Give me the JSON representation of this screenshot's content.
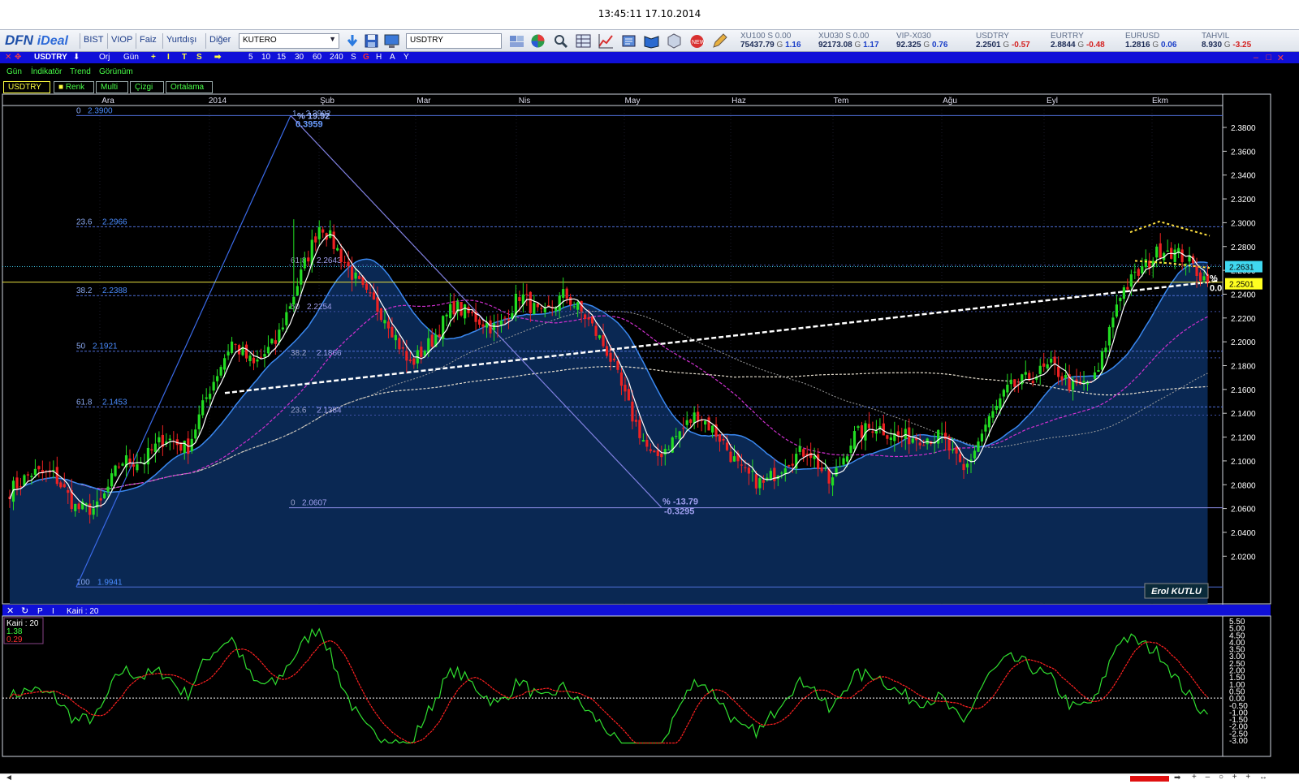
{
  "window": {
    "timestamp": "13:45:11 17.10.2014"
  },
  "toolbar": {
    "logo_dfn": "DFN",
    "logo_ideal": "iDeal",
    "menu": [
      "BIST",
      "VIOP",
      "Faiz",
      "Yurtdışı",
      "Diğer"
    ],
    "broker_value": "KUTERO",
    "symbol_value": "USDTRY",
    "icons": [
      "download-icon",
      "save-icon",
      "monitor-icon",
      "layout-icon",
      "globe-icon",
      "search-icon",
      "table-icon",
      "chart-icon",
      "news-icon",
      "book-icon",
      "cube-icon",
      "alert-icon",
      "pen-icon"
    ]
  },
  "quotes": [
    {
      "name": "XU100",
      "s": "S 0.00",
      "value": "75437.79",
      "g_label": "G",
      "change": "1.16",
      "dir": "pos"
    },
    {
      "name": "XU030",
      "s": "S 0.00",
      "value": "92173.08",
      "g_label": "G",
      "change": "1.17",
      "dir": "pos"
    },
    {
      "name": "VIP-X030",
      "s": "",
      "value": "92.325",
      "g_label": "G",
      "change": "0.76",
      "dir": "pos"
    },
    {
      "name": "USDTRY",
      "s": "",
      "value": "2.2501",
      "g_label": "G",
      "change": "-0.57",
      "dir": "neg"
    },
    {
      "name": "EURTRY",
      "s": "",
      "value": "2.8844",
      "g_label": "G",
      "change": "-0.48",
      "dir": "neg"
    },
    {
      "name": "EURUSD",
      "s": "",
      "value": "1.2816",
      "g_label": "G",
      "change": "0.06",
      "dir": "pos"
    },
    {
      "name": "TAHVIL",
      "s": "",
      "value": "8.930",
      "g_label": "G",
      "change": "-3.25",
      "dir": "neg"
    }
  ],
  "chart_header": {
    "symbol": "USDTRY",
    "orj": "Orj",
    "period": "Gün",
    "tools": [
      "+",
      "I",
      "T",
      "S",
      "➡"
    ],
    "periods": [
      "5",
      "10",
      "15",
      "30",
      "60",
      "240",
      "S",
      "G",
      "H",
      "A",
      "Y"
    ],
    "active_period": "G"
  },
  "submenu": [
    "Gün",
    "İndikatör",
    "Trend",
    "Görünüm"
  ],
  "tabs": [
    "USDTRY",
    "Renk",
    "Multi",
    "Çizgi",
    "Ortalama"
  ],
  "months": [
    "Ara",
    "2014",
    "Şub",
    "Mar",
    "Nis",
    "May",
    "Haz",
    "Tem",
    "Ağu",
    "Eyl",
    "Ekm"
  ],
  "colors": {
    "up": "#22dd22",
    "down": "#ee2222",
    "fib_line": "#4f6fd8",
    "bg": "#000000",
    "area": "#0b2a57",
    "ma_blue": "#3a88f0",
    "ma_magenta": "#d030d0"
  },
  "price_axis": [
    "2.3800",
    "2.3600",
    "2.3400",
    "2.3200",
    "2.3000",
    "2.2800",
    "2.2600",
    "2.2400",
    "2.2200",
    "2.2000",
    "2.1800",
    "2.1600",
    "2.1400",
    "2.1200",
    "2.1000",
    "2.0800",
    "2.0600",
    "2.0400",
    "2.0200"
  ],
  "price_tags": {
    "cyan": "2.2631",
    "yellow": "2.2501"
  },
  "fib_main": [
    {
      "pct": "0",
      "price": "2.3900"
    },
    {
      "pct": "23.6",
      "price": "2.2966"
    },
    {
      "pct": "38.2",
      "price": "2.2388"
    },
    {
      "pct": "50",
      "price": "2.1921"
    },
    {
      "pct": "61.8",
      "price": "2.1453"
    },
    {
      "pct": "100",
      "price": "1.9941"
    }
  ],
  "fib_second": [
    {
      "pct": "61.8",
      "price": "2.2643"
    },
    {
      "pct": "50",
      "price": "2.2254"
    },
    {
      "pct": "38.2",
      "price": "2.1866"
    },
    {
      "pct": "23.6",
      "price": "2.1384"
    },
    {
      "pct": "0",
      "price": "2.0607"
    }
  ],
  "annotations": {
    "peak_pct": "% 19.92",
    "peak_change": "0.3959",
    "trough_pct": "% -13.79",
    "trough_change": "-0.3295",
    "right_pct": "%",
    "right_zero": "0.0",
    "author": "Erol KUTLU",
    "fib_top_extra": "1 .. 2.3902"
  },
  "indicator": {
    "header_label": "Kairi : 20",
    "legend_title": "Kairi : 20",
    "value_green": "1.38",
    "value_red": "0.29",
    "axis": [
      "5.50",
      "5.00",
      "4.50",
      "4.00",
      "3.50",
      "3.00",
      "2.50",
      "2.00",
      "1.50",
      "1.00",
      "0.50",
      "0.00",
      "-0.50",
      "-1.00",
      "-1.50",
      "-2.00",
      "-2.50",
      "-3.00"
    ]
  },
  "chart_data": {
    "type": "candlestick",
    "symbol": "USDTRY",
    "y_range": [
      2.0,
      2.395
    ],
    "x_months": [
      "Ara",
      "2014",
      "Şub",
      "Mar",
      "Nis",
      "May",
      "Haz",
      "Tem",
      "Ağu",
      "Eyl",
      "Ekm"
    ],
    "fib_retracement_main": {
      "high": 2.39,
      "low": 1.9941,
      "levels": [
        [
          0,
          2.39
        ],
        [
          23.6,
          2.2966
        ],
        [
          38.2,
          2.2388
        ],
        [
          50,
          2.1921
        ],
        [
          61.8,
          2.1453
        ],
        [
          100,
          1.9941
        ]
      ]
    },
    "fib_retracement_second": {
      "levels": [
        [
          61.8,
          2.2643
        ],
        [
          50,
          2.2254
        ],
        [
          38.2,
          2.1866
        ],
        [
          23.6,
          2.1384
        ],
        [
          0,
          2.0607
        ]
      ]
    },
    "last_close": 2.2501,
    "marked_price": 2.2631,
    "close_anchors": [
      2.075,
      2.09,
      2.088,
      2.06,
      2.06,
      2.1,
      2.1,
      2.12,
      2.11,
      2.16,
      2.2,
      2.18,
      2.2,
      2.25,
      2.3,
      2.27,
      2.24,
      2.22,
      2.18,
      2.2,
      2.23,
      2.22,
      2.21,
      2.24,
      2.22,
      2.24,
      2.22,
      2.19,
      2.14,
      2.1,
      2.12,
      2.14,
      2.12,
      2.09,
      2.08,
      2.1,
      2.11,
      2.08,
      2.12,
      2.13,
      2.12,
      2.12,
      2.12,
      2.09,
      2.13,
      2.16,
      2.17,
      2.18,
      2.16,
      2.17,
      2.24,
      2.26,
      2.28,
      2.27,
      2.25
    ],
    "indicator": {
      "name": "Kairi",
      "period": 20,
      "y_range": [
        -3.0,
        5.5
      ],
      "last_green": 1.38,
      "last_red": 0.29
    }
  }
}
